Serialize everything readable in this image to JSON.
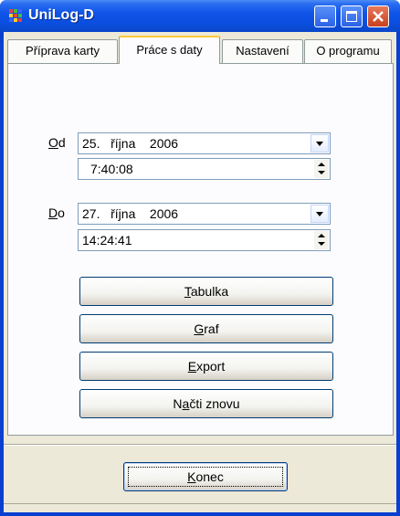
{
  "window": {
    "title": "UniLog-D"
  },
  "tabs": [
    {
      "label": "Příprava karty"
    },
    {
      "label": "Práce s daty"
    },
    {
      "label": "Nastavení"
    },
    {
      "label": "O programu"
    }
  ],
  "from": {
    "accel": "O",
    "label_rest": "d",
    "date": "25.   října    2006",
    "time": "7:40:08"
  },
  "to": {
    "accel": "D",
    "label_rest": "o",
    "date": "27.   října    2006",
    "time": "14:24:41"
  },
  "buttons": {
    "tabulka": {
      "accel": "T",
      "rest": "abulka"
    },
    "graf": {
      "accel": "G",
      "rest": "raf"
    },
    "export": {
      "accel": "E",
      "rest": "xport"
    },
    "nacti": {
      "pre": "N",
      "accel": "a",
      "rest": "čti znovu"
    },
    "konec": {
      "accel": "K",
      "rest": "onec"
    }
  },
  "colors": {
    "titlebar": "#0b4fe0",
    "window_face": "#ece9d8",
    "tab_highlight": "#ffc83c"
  }
}
